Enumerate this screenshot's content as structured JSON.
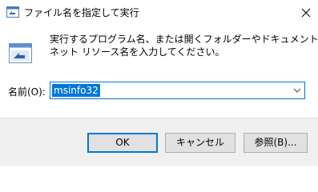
{
  "window": {
    "title": "ファイル名を指定して実行",
    "close_icon": "close-icon",
    "title_icon": "run-icon"
  },
  "main": {
    "icon": "run-dialog-icon",
    "description_lines": [
      "実行するプログラム名、または開くフォルダーやドキュメント名、インター",
      "ネット リソース名を入力してください。"
    ],
    "open_label": "名前(O):",
    "open_value": "msinfo32"
  },
  "buttons": {
    "ok": "OK",
    "cancel": "キャンセル",
    "browse": "参照(B)..."
  },
  "colors": {
    "accent": "#0078d7",
    "footer_bg": "#f0f0f0"
  }
}
